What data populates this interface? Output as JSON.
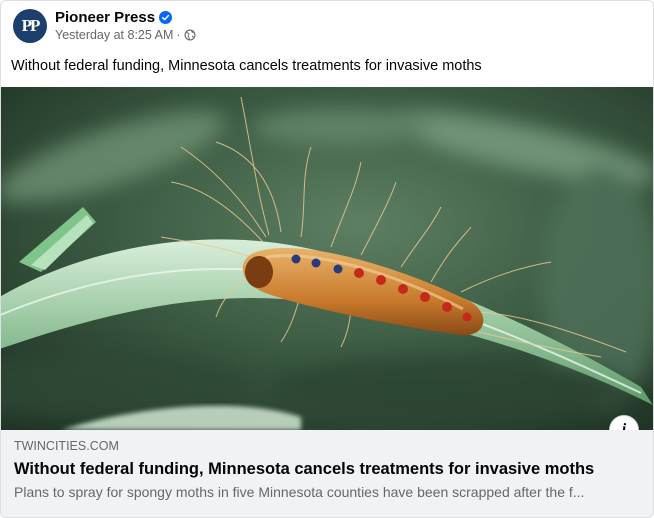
{
  "post": {
    "page_name": "Pioneer Press",
    "avatar_text": "PP",
    "timestamp": "Yesterday at 8:25 AM",
    "separator": "·",
    "audience_icon": "globe-icon",
    "verified_icon": "verified-badge-icon",
    "text": "Without federal funding, Minnesota cancels treatments for invasive moths"
  },
  "link_preview": {
    "domain": "TWINCITIES.COM",
    "title": "Without federal funding, Minnesota cancels treatments for invasive moths",
    "description": "Plans to spray for spongy moths in five Minnesota counties have been scrapped after the f...",
    "info_label": "i"
  },
  "colors": {
    "brand_avatar": "#1d3f6e",
    "verified_blue": "#0866ff",
    "secondary_text": "#65676b",
    "preview_bg": "#f0f2f5"
  }
}
